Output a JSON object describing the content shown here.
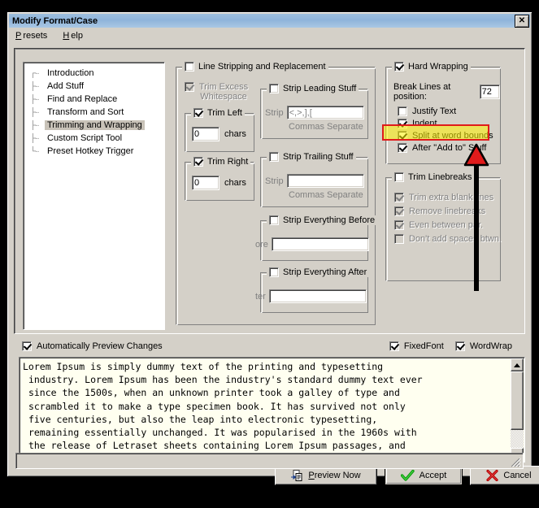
{
  "window": {
    "title": "Modify Format/Case",
    "close_label": "✕"
  },
  "menu": {
    "items": [
      {
        "label": "Presets",
        "mnemonic": "P"
      },
      {
        "label": "Help",
        "mnemonic": "H"
      }
    ]
  },
  "tree": {
    "items": [
      {
        "label": "Introduction",
        "selected": false
      },
      {
        "label": "Add Stuff",
        "selected": false
      },
      {
        "label": "Find and Replace",
        "selected": false
      },
      {
        "label": "Transform and Sort",
        "selected": false
      },
      {
        "label": "Trimming and Wrapping",
        "selected": true
      },
      {
        "label": "Custom Script Tool",
        "selected": false
      },
      {
        "label": "Preset Hotkey Trigger",
        "selected": false
      }
    ]
  },
  "line_stripping": {
    "group_label": "Line Stripping and Replacement",
    "group_checked": false,
    "trim_excess": {
      "label_line1": "Trim Excess",
      "label_line2": "Whitespace",
      "checked": true,
      "enabled": false
    },
    "trim_left": {
      "label": "Trim Left",
      "checked": true,
      "value": "0",
      "unit": "chars"
    },
    "trim_right": {
      "label": "Trim Right",
      "checked": true,
      "value": "0",
      "unit": "chars"
    },
    "strip_leading": {
      "label": "Strip Leading Stuff",
      "checked": false,
      "field_label": "Strip",
      "value": "<,>,],[",
      "hint": "Commas Separate"
    },
    "strip_trailing": {
      "label": "Strip Trailing Stuff",
      "checked": false,
      "field_label": "Strip",
      "value": "",
      "hint": "Commas Separate"
    },
    "strip_before": {
      "label": "Strip Everything Before",
      "checked": false,
      "field_label": "ore",
      "value": ""
    },
    "strip_after": {
      "label": "Strip Everything After",
      "checked": false,
      "field_label": "ter",
      "value": ""
    }
  },
  "hard_wrapping": {
    "group_label": "Hard Wrapping",
    "group_checked": true,
    "break_label": "Break Lines at position:",
    "break_value": "72",
    "options": [
      {
        "label": "Justify Text",
        "checked": false,
        "highlighted": false
      },
      {
        "label": "Indent",
        "checked": true,
        "highlighted": false
      },
      {
        "label": "Split at word bounds",
        "checked": true,
        "highlighted": true
      },
      {
        "label": "After \"Add to\" Stuff",
        "checked": true,
        "highlighted": false
      }
    ]
  },
  "trim_linebreaks": {
    "group_label": "Trim Linebreaks",
    "group_checked": false,
    "enabled": false,
    "options": [
      {
        "label": "Trim extra blank lines",
        "checked": true
      },
      {
        "label": "Remove linebreaks",
        "checked": true
      },
      {
        "label": "Even between par.",
        "checked": true
      },
      {
        "label": "Don't add spaces btwn.",
        "checked": false
      }
    ]
  },
  "preview_options": {
    "auto_preview": {
      "label": "Automatically Preview Changes",
      "checked": true
    },
    "fixed_font": {
      "label": "FixedFont",
      "checked": true
    },
    "word_wrap": {
      "label": "WordWrap",
      "checked": true
    }
  },
  "preview": {
    "text": "Lorem Ipsum is simply dummy text of the printing and typesetting\n industry. Lorem Ipsum has been the industry's standard dummy text ever\n since the 1500s, when an unknown printer took a galley of type and\n scrambled it to make a type specimen book. It has survived not only\n five centuries, but also the leap into electronic typesetting,\n remaining essentially unchanged. It was popularised in the 1960s with\n the release of Letraset sheets containing Lorem Ipsum passages, and\n more recently with desktop publishing software like Aldus PageMaker"
  },
  "buttons": {
    "preview_now": {
      "label": "Preview Now",
      "mnemonic": "P"
    },
    "accept": {
      "label": "Accept"
    },
    "cancel": {
      "label": "Cancel"
    }
  },
  "status": {
    "text": ""
  },
  "annotation": {
    "highlight_color": "#fff200",
    "border_color": "#e01b1b",
    "arrow_color": "#e01b1b",
    "arrow_shaft_color": "#000000",
    "target": "Split at word bounds"
  }
}
